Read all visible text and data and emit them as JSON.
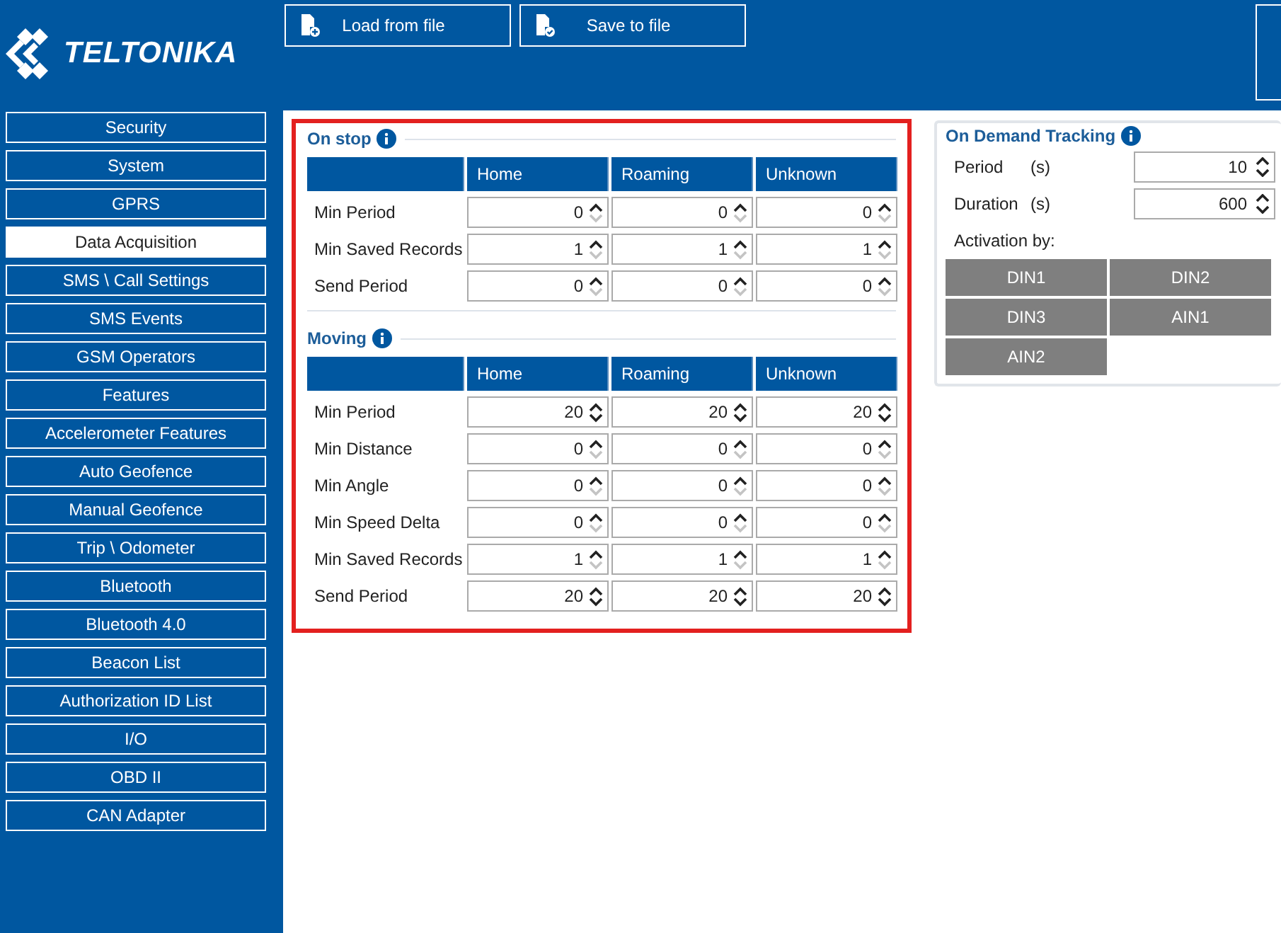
{
  "toolbar": {
    "buttons": [
      {
        "kind": "load",
        "label": "Load from file"
      },
      {
        "kind": "save",
        "label": "Save to file"
      }
    ]
  },
  "logo": {
    "text": "TELTONIKA"
  },
  "sidebar": {
    "items": [
      {
        "label": "Security",
        "selected": false
      },
      {
        "label": "System",
        "selected": false
      },
      {
        "label": "GPRS",
        "selected": false
      },
      {
        "label": "Data Acquisition",
        "selected": true
      },
      {
        "label": "SMS \\ Call Settings",
        "selected": false
      },
      {
        "label": "SMS Events",
        "selected": false
      },
      {
        "label": "GSM Operators",
        "selected": false
      },
      {
        "label": "Features",
        "selected": false
      },
      {
        "label": "Accelerometer Features",
        "selected": false
      },
      {
        "label": "Auto Geofence",
        "selected": false
      },
      {
        "label": "Manual Geofence",
        "selected": false
      },
      {
        "label": "Trip \\ Odometer",
        "selected": false
      },
      {
        "label": "Bluetooth",
        "selected": false
      },
      {
        "label": "Bluetooth 4.0",
        "selected": false
      },
      {
        "label": "Beacon List",
        "selected": false
      },
      {
        "label": "Authorization ID List",
        "selected": false
      },
      {
        "label": "I/O",
        "selected": false
      },
      {
        "label": "OBD II",
        "selected": false
      },
      {
        "label": "CAN Adapter",
        "selected": false
      }
    ]
  },
  "sections": [
    {
      "title": "On stop",
      "columns": [
        "Home",
        "Roaming",
        "Unknown"
      ],
      "rows": [
        {
          "label": "Min Period",
          "cells": [
            {
              "value": "0",
              "at_min": true
            },
            {
              "value": "0",
              "at_min": true
            },
            {
              "value": "0",
              "at_min": true
            }
          ]
        },
        {
          "label": "Min Saved Records",
          "cells": [
            {
              "value": "1",
              "at_min": true
            },
            {
              "value": "1",
              "at_min": true
            },
            {
              "value": "1",
              "at_min": true
            }
          ]
        },
        {
          "label": "Send Period",
          "cells": [
            {
              "value": "0",
              "at_min": true
            },
            {
              "value": "0",
              "at_min": true
            },
            {
              "value": "0",
              "at_min": true
            }
          ]
        }
      ]
    },
    {
      "title": "Moving",
      "columns": [
        "Home",
        "Roaming",
        "Unknown"
      ],
      "rows": [
        {
          "label": "Min Period",
          "cells": [
            {
              "value": "20",
              "at_min": false
            },
            {
              "value": "20",
              "at_min": false
            },
            {
              "value": "20",
              "at_min": false
            }
          ]
        },
        {
          "label": "Min Distance",
          "cells": [
            {
              "value": "0",
              "at_min": true
            },
            {
              "value": "0",
              "at_min": true
            },
            {
              "value": "0",
              "at_min": true
            }
          ]
        },
        {
          "label": "Min Angle",
          "cells": [
            {
              "value": "0",
              "at_min": true
            },
            {
              "value": "0",
              "at_min": true
            },
            {
              "value": "0",
              "at_min": true
            }
          ]
        },
        {
          "label": "Min Speed Delta",
          "cells": [
            {
              "value": "0",
              "at_min": true
            },
            {
              "value": "0",
              "at_min": true
            },
            {
              "value": "0",
              "at_min": true
            }
          ]
        },
        {
          "label": "Min Saved Records",
          "cells": [
            {
              "value": "1",
              "at_min": true
            },
            {
              "value": "1",
              "at_min": true
            },
            {
              "value": "1",
              "at_min": true
            }
          ]
        },
        {
          "label": "Send Period",
          "cells": [
            {
              "value": "20",
              "at_min": false
            },
            {
              "value": "20",
              "at_min": false
            },
            {
              "value": "20",
              "at_min": false
            }
          ]
        }
      ]
    }
  ],
  "on_demand": {
    "title": "On Demand Tracking",
    "fields": [
      {
        "label": "Period",
        "unit": "(s)",
        "value": "10"
      },
      {
        "label": "Duration",
        "unit": "(s)",
        "value": "600"
      }
    ],
    "activation_label": "Activation by:",
    "activation_buttons": [
      "DIN1",
      "DIN2",
      "DIN3",
      "AIN1",
      "AIN2"
    ]
  }
}
